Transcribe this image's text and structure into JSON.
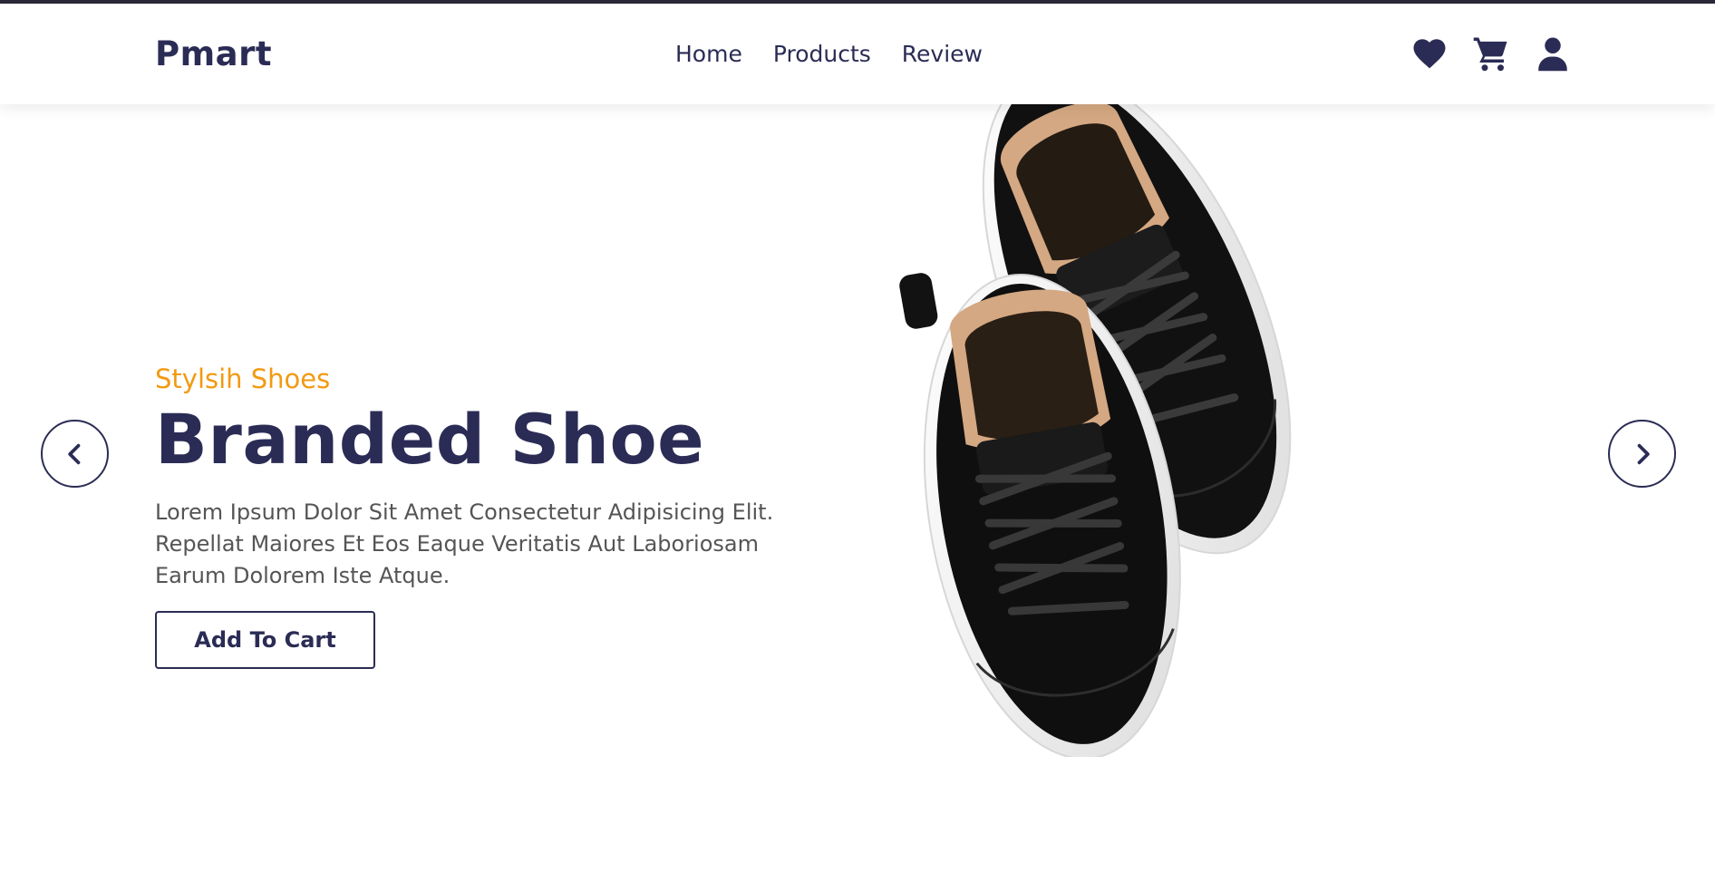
{
  "header": {
    "logo": "Pmart",
    "nav": [
      {
        "label": "Home"
      },
      {
        "label": "Products"
      },
      {
        "label": "Review"
      }
    ],
    "icons": [
      "heart-icon",
      "cart-icon",
      "user-icon"
    ]
  },
  "hero": {
    "subtitle": "Stylsih Shoes",
    "title": "Branded Shoe",
    "description": "Lorem Ipsum Dolor Sit Amet Consectetur Adipisicing Elit. Repellat Maiores Et Eos Eaque Veritatis Aut Laboriosam Earum Dolorem Iste Atque.",
    "button_label": "Add To Cart",
    "prev_icon": "chevron-left-icon",
    "next_icon": "chevron-right-icon",
    "image": "black-sneakers-image"
  },
  "colors": {
    "primary": "#2b2c55",
    "accent": "#f29a12",
    "text_muted": "#555555",
    "background": "#ffffff"
  }
}
